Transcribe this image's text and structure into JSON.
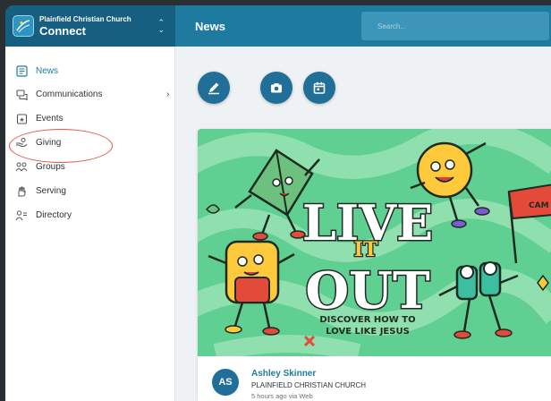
{
  "header": {
    "org_name": "Plainfield Christian Church",
    "app_name": "Connect",
    "page_title": "News",
    "search_placeholder": "Search..."
  },
  "sidebar": {
    "items": [
      {
        "label": "News",
        "icon": "news-icon",
        "active": true
      },
      {
        "label": "Communications",
        "icon": "communications-icon",
        "has_submenu": true
      },
      {
        "label": "Events",
        "icon": "events-icon"
      },
      {
        "label": "Giving",
        "icon": "giving-icon",
        "highlighted": true
      },
      {
        "label": "Groups",
        "icon": "groups-icon"
      },
      {
        "label": "Serving",
        "icon": "serving-icon"
      },
      {
        "label": "Directory",
        "icon": "directory-icon"
      }
    ]
  },
  "actions": [
    {
      "icon": "pencil-icon"
    },
    {
      "icon": "camera-icon"
    },
    {
      "icon": "calendar-icon"
    }
  ],
  "post": {
    "banner": {
      "line1": "LIVE",
      "line2": "IT",
      "line3": "OUT",
      "tagline1": "DISCOVER HOW TO",
      "tagline2": "LOVE LIKE JESUS",
      "flag_text": "CAM"
    },
    "author_initials": "AS",
    "author_name": "Ashley Skinner",
    "author_org": "PLAINFIELD CHRISTIAN CHURCH",
    "meta": "5 hours ago via Web"
  },
  "colors": {
    "brand": "#1f7aa0",
    "brand_dark": "#175f80",
    "annotation": "#e0574b"
  }
}
